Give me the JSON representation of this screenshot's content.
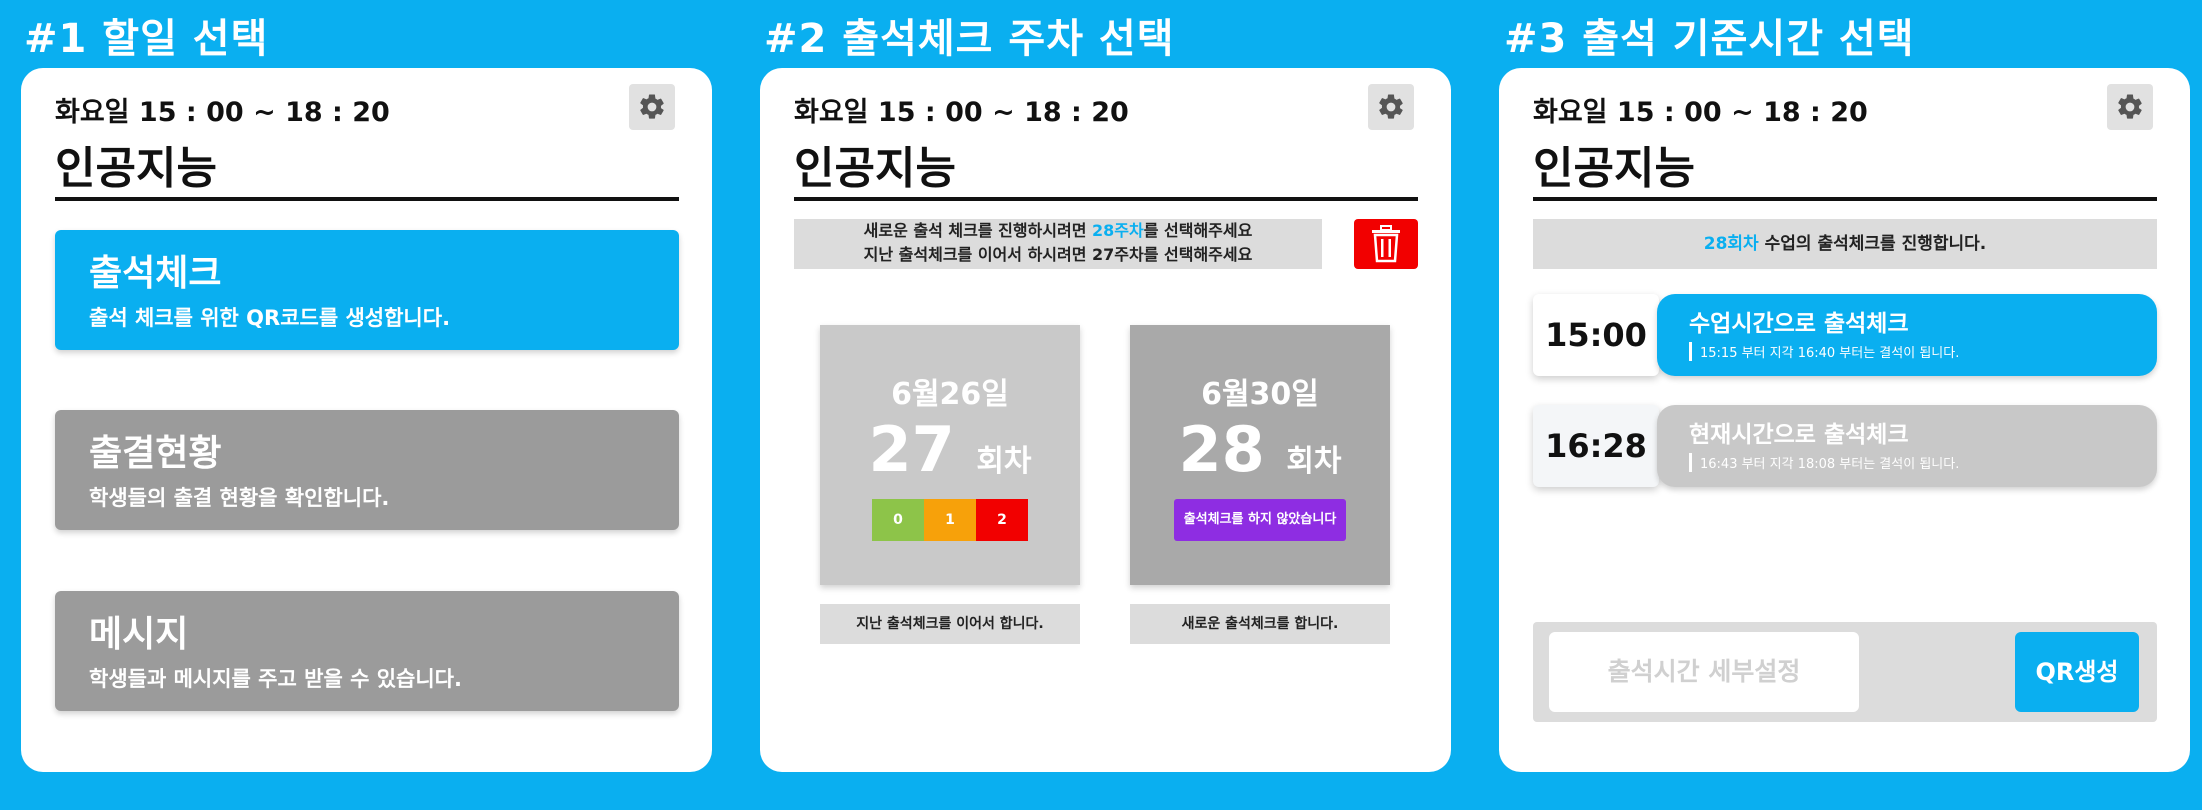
{
  "colors": {
    "accent": "#0aaff0",
    "gray_card": "#9b9b9b",
    "red": "#f20000",
    "purple": "#8e2de2",
    "green": "#8dc449",
    "orange": "#f7a10a"
  },
  "headings": [
    "#1 할일 선택",
    "#2 출석체크 주차 선택",
    "#3 출석 기준시간 선택"
  ],
  "class_info": {
    "time": "화요일 15 : 00 ~ 18 : 20",
    "subject": "인공지능"
  },
  "panel1": {
    "cards": [
      {
        "title": "출석체크",
        "desc": "출석 체크를 위한 QR코드를 생성합니다."
      },
      {
        "title": "출결현황",
        "desc": "학생들의 출결 현황을 확인합니다."
      },
      {
        "title": "메시지",
        "desc": "학생들과 메시지를 주고 받을 수 있습니다."
      }
    ]
  },
  "panel2": {
    "notice": {
      "l1_pre": "새로운 출석 체크를 진행하시려면 ",
      "l1_hl": "28주차",
      "l1_post": "를 선택해주세요",
      "l2": "지난 출석체크를 이어서 하시려면 27주차를 선택해주세요"
    },
    "weeks": [
      {
        "date": "6월26일",
        "number": "27",
        "unit": "회차",
        "counts": [
          "0",
          "1",
          "2"
        ],
        "button": "지난 출석체크를 이어서 합니다."
      },
      {
        "date": "6월30일",
        "number": "28",
        "unit": "회차",
        "status": "출석체크를 하지 않았습니다",
        "button": "새로운 출석체크를 합니다."
      }
    ]
  },
  "panel3": {
    "banner_hl": "28회차",
    "banner_rest": " 수업의 출석체크를 진행합니다.",
    "options": [
      {
        "time": "15:00",
        "label": "수업시간으로 출석체크",
        "note": "15:15 부터 지각 16:40 부터는 결석이 됩니다."
      },
      {
        "time": "16:28",
        "label": "현재시간으로 출석체크",
        "note": "16:43 부터 지각 18:08 부터는 결석이 됩니다."
      }
    ],
    "detail_button": "출석시간 세부설정",
    "qr_button": "QR생성"
  }
}
